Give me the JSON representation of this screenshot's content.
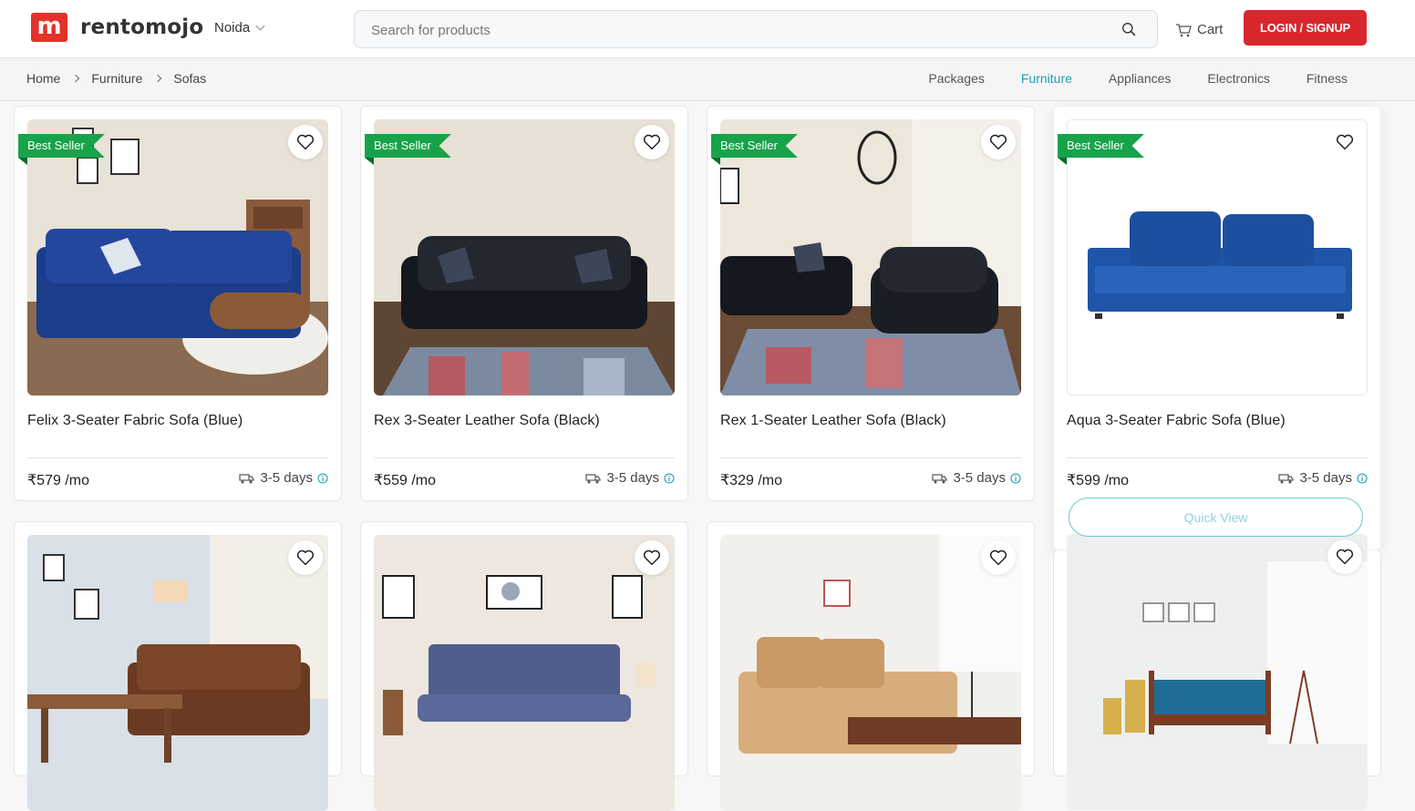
{
  "brand": {
    "logo_letter": "m",
    "name": "rentomojo",
    "accent": "#e4312b"
  },
  "header": {
    "city": "Noida",
    "search_placeholder": "Search for products",
    "cart_label": "Cart",
    "login_label": "LOGIN / SIGNUP"
  },
  "breadcrumb": [
    "Home",
    "Furniture",
    "Sofas"
  ],
  "categories": [
    {
      "label": "Packages",
      "active": false
    },
    {
      "label": "Furniture",
      "active": true
    },
    {
      "label": "Appliances",
      "active": false
    },
    {
      "label": "Electronics",
      "active": false
    },
    {
      "label": "Fitness",
      "active": false
    }
  ],
  "products": [
    {
      "name": "Felix 3-Seater Fabric Sofa (Blue)",
      "price": "₹579 /mo",
      "delivery": "3-5 days",
      "badge": "Best Seller",
      "icon": "blue-fabric-sofa-photo"
    },
    {
      "name": "Rex 3-Seater Leather Sofa (Black)",
      "price": "₹559 /mo",
      "delivery": "3-5 days",
      "badge": "Best Seller",
      "icon": "black-leather-sofa-photo"
    },
    {
      "name": "Rex 1-Seater Leather Sofa (Black)",
      "price": "₹329 /mo",
      "delivery": "3-5 days",
      "badge": "Best Seller",
      "icon": "black-leather-armchair-photo"
    },
    {
      "name": "Aqua 3-Seater Fabric Sofa (Blue)",
      "price": "₹599 /mo",
      "delivery": "3-5 days",
      "badge": "Best Seller",
      "icon": "aqua-blue-sofa-photo"
    },
    {
      "icon": "brown-sofa-photo"
    },
    {
      "icon": "grey-sofa-cum-bed-photo"
    },
    {
      "icon": "beige-sofa-photo"
    },
    {
      "icon": "teal-wooden-sofa-photo"
    }
  ],
  "quick_view_label": "Quick View",
  "colors": {
    "badge": "#17a34a",
    "link_active": "#1aa0b8",
    "login": "#d9262d"
  }
}
